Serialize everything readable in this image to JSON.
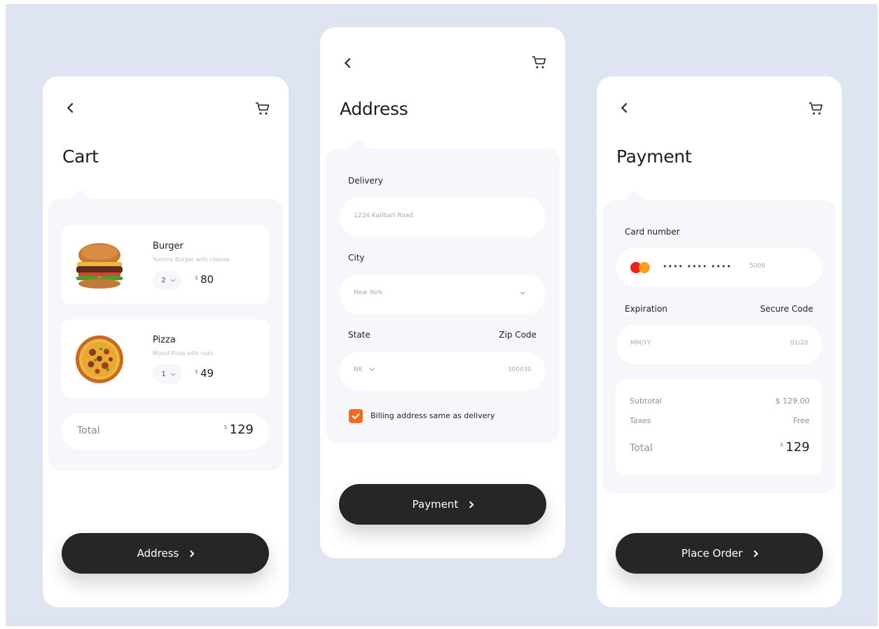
{
  "cart_screen": {
    "title": "Cart",
    "items": [
      {
        "name": "Burger",
        "description": "Yummy Burger with cheese",
        "qty": "2",
        "currency": "$",
        "price": "80"
      },
      {
        "name": "Pizza",
        "description": "Mixed Pizza with nuts",
        "qty": "1",
        "currency": "$",
        "price": "49"
      }
    ],
    "total_label": "Total",
    "total_currency": "$",
    "total_value": "129",
    "button_label": "Address"
  },
  "address_screen": {
    "title": "Address",
    "delivery_label": "Delivery",
    "delivery_value": "1234 Kalibari Road",
    "city_label": "City",
    "city_value": "New York",
    "state_label": "State",
    "zip_label": "Zip Code",
    "state_value": "NK",
    "zip_value": "300030",
    "billing_label": "Billing address same as delivery",
    "billing_checked": true,
    "button_label": "Payment"
  },
  "payment_screen": {
    "title": "Payment",
    "card_label": "Card number",
    "card_masked": "•••• •••• ••••",
    "card_last4": "5000",
    "expiration_label": "Expiration",
    "secure_label": "Secure Code",
    "expiration_placeholder": "MM/YY",
    "secure_value": "01/20",
    "subtotal_label": "Subtotal",
    "subtotal_value": "$ 129.00",
    "taxes_label": "Taxes",
    "taxes_value": "Free",
    "total_label": "Total",
    "total_currency": "$",
    "total_value": "129",
    "button_label": "Place Order"
  },
  "colors": {
    "background": "#dfe4f2",
    "button": "#262626",
    "accent": "#f26b21",
    "panel": "#f5f7fb"
  },
  "icons": [
    "back-arrow-icon",
    "cart-icon",
    "chevron-down-icon",
    "checkmark-icon",
    "mastercard-icon",
    "chevron-right-icon"
  ]
}
